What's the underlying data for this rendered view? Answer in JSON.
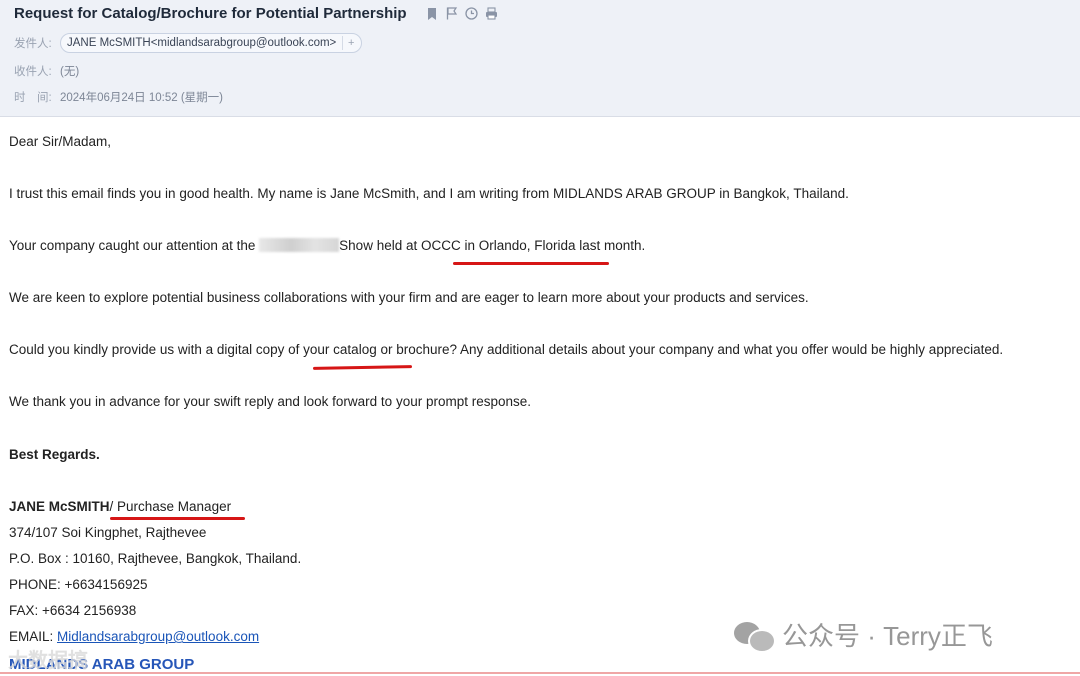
{
  "header": {
    "subject": "Request for Catalog/Brochure for Potential Partnership",
    "icons": [
      "bookmark-icon",
      "flag-icon",
      "clock-icon",
      "print-icon"
    ],
    "from_label": "发件人:",
    "from_value": "JANE McSMITH<midlandsarabgroup@outlook.com>",
    "add_contact_symbol": "+",
    "to_label": "收件人:",
    "to_value": "(无)",
    "time_label": "时　间:",
    "time_value": "2024年06月24日 10:52 (星期一)"
  },
  "body": {
    "greeting": "Dear Sir/Madam,",
    "p1": "I trust this email finds you in good health. My name is Jane McSmith, and I am writing from MIDLANDS ARAB GROUP in Bangkok, Thailand.",
    "p2_before": "Your company caught our attention at the ",
    "p2_after": "Show held at OCCC in Orlando, Florida last month.",
    "p3": "We are keen to explore potential business collaborations with your firm and are eager to learn more about your products and services.",
    "p4": "Could you kindly provide us with a digital copy of your catalog or brochure? Any additional details about your company and what you offer would be highly appreciated.",
    "p5": "We thank you in advance for your swift reply and look forward to your prompt response.",
    "closing": "Best Regards.",
    "sig_name": "JANE McSMITH",
    "sig_title": "/ Purchase Manager",
    "sig_addr1": " 374/107 Soi Kingphet,  Rajthevee",
    "sig_addr2": "P.O. Box : 10160, Rajthevee,  Bangkok, Thailand.",
    "sig_phone": "PHONE: +6634156925",
    "sig_fax": "FAX:  +6634 2156938",
    "sig_email_label": "EMAIL: ",
    "sig_email": "Midlandsarabgroup@outlook.com",
    "sig_company": "MIDLANDS ARAB GROUP"
  },
  "annotation_color": "#d61616",
  "watermark": {
    "text": "公众号 · Terry正飞",
    "secondary": "大数据搞"
  }
}
